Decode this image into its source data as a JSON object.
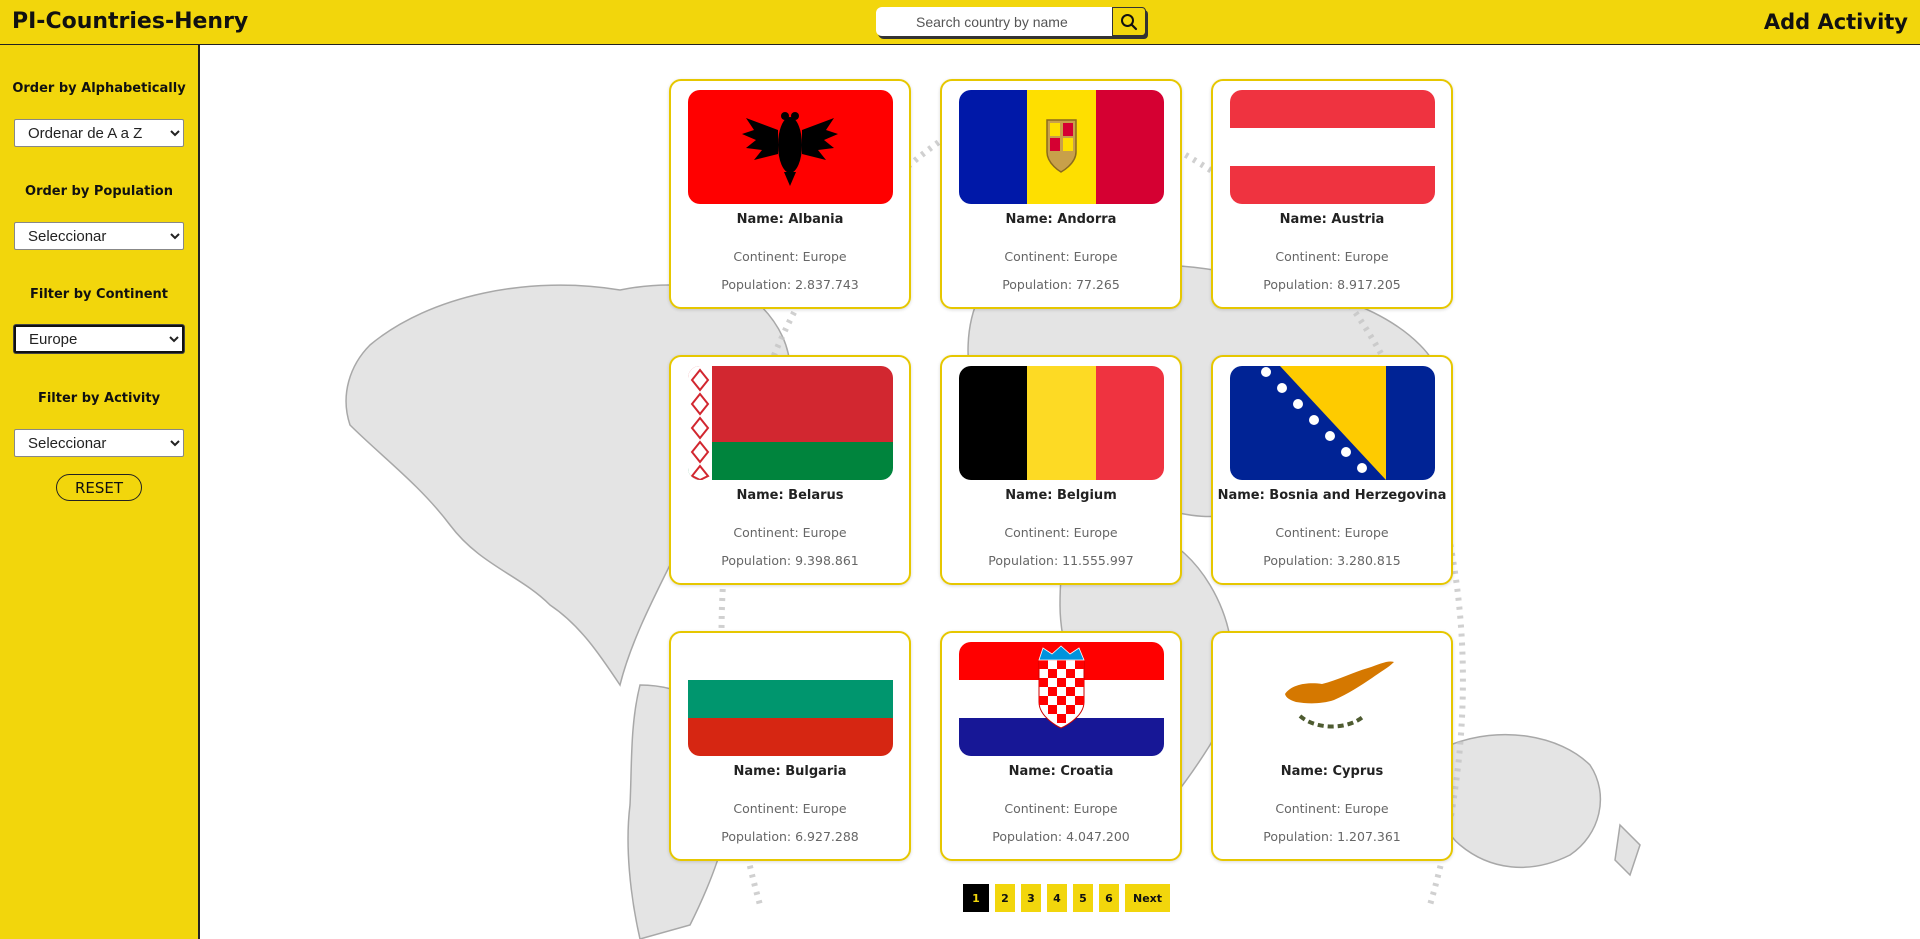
{
  "header": {
    "app_title": "PI-Countries-Henry",
    "search_placeholder": "Search country by name",
    "search_icon": "search-icon",
    "add_activity_label": "Add Activity"
  },
  "sidebar": {
    "order_alpha_label": "Order by Alphabetically",
    "order_alpha_value": "Ordenar de A a Z",
    "order_population_label": "Order by Population",
    "order_population_value": "Seleccionar",
    "filter_continent_label": "Filter by Continent",
    "filter_continent_value": "Europe",
    "filter_activity_label": "Filter by Activity",
    "filter_activity_value": "Seleccionar",
    "reset_label": "RESET"
  },
  "cards": [
    {
      "name": "Name: Albania",
      "continent": "Continent: Europe",
      "population": "Population: 2.837.743",
      "flag": "albania-flag"
    },
    {
      "name": "Name: Andorra",
      "continent": "Continent: Europe",
      "population": "Population: 77.265",
      "flag": "andorra-flag"
    },
    {
      "name": "Name: Austria",
      "continent": "Continent: Europe",
      "population": "Population: 8.917.205",
      "flag": "austria-flag"
    },
    {
      "name": "Name: Belarus",
      "continent": "Continent: Europe",
      "population": "Population: 9.398.861",
      "flag": "belarus-flag"
    },
    {
      "name": "Name: Belgium",
      "continent": "Continent: Europe",
      "population": "Population: 11.555.997",
      "flag": "belgium-flag"
    },
    {
      "name": "Name: Bosnia and Herzegovina",
      "continent": "Continent: Europe",
      "population": "Population: 3.280.815",
      "flag": "bosnia-flag"
    },
    {
      "name": "Name: Bulgaria",
      "continent": "Continent: Europe",
      "population": "Population: 6.927.288",
      "flag": "bulgaria-flag"
    },
    {
      "name": "Name: Croatia",
      "continent": "Continent: Europe",
      "population": "Population: 4.047.200",
      "flag": "croatia-flag"
    },
    {
      "name": "Name: Cyprus",
      "continent": "Continent: Europe",
      "population": "Population: 1.207.361",
      "flag": "cyprus-flag"
    }
  ],
  "pagination": {
    "pages": [
      "1",
      "2",
      "3",
      "4",
      "5",
      "6"
    ],
    "current": "1",
    "next_label": "Next"
  },
  "colors": {
    "brand_yellow": "#f2d60c",
    "card_border": "#e6c700",
    "current_page_bg": "#000000"
  }
}
